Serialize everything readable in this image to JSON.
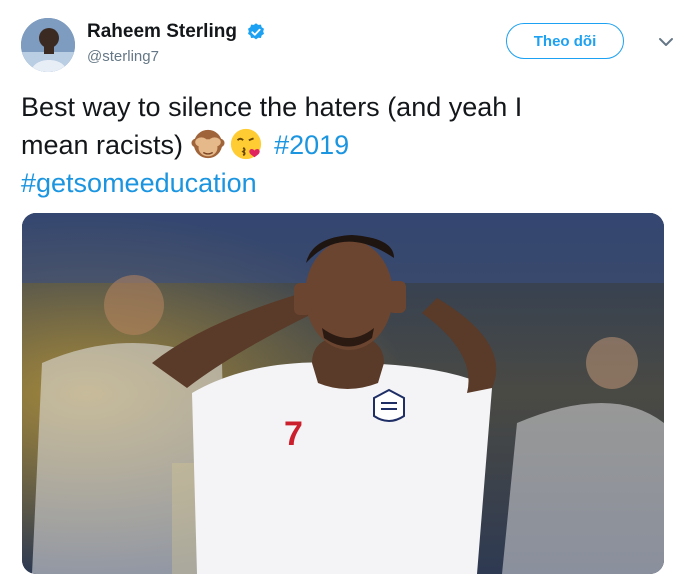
{
  "user": {
    "display_name": "Raheem Sterling",
    "handle": "@sterling7",
    "verified": true,
    "avatar_icon": "profile-photo"
  },
  "actions": {
    "follow_label": "Theo dõi",
    "caret_icon": "chevron-down-icon"
  },
  "tweet": {
    "line1": "Best way to silence the haters (and yeah I",
    "line2_text": "mean racists)",
    "emojis": [
      "see-no-evil-monkey",
      "face-blowing-kiss"
    ],
    "hashtag1": "#2019",
    "hashtag2": "#getsomeeducation"
  },
  "media": {
    "description_icon": "photo",
    "shirt_number": "7"
  },
  "colors": {
    "accent": "#1da1f2",
    "hashtag": "#1b95e0",
    "text": "#14171a",
    "secondary_text": "#657786"
  }
}
